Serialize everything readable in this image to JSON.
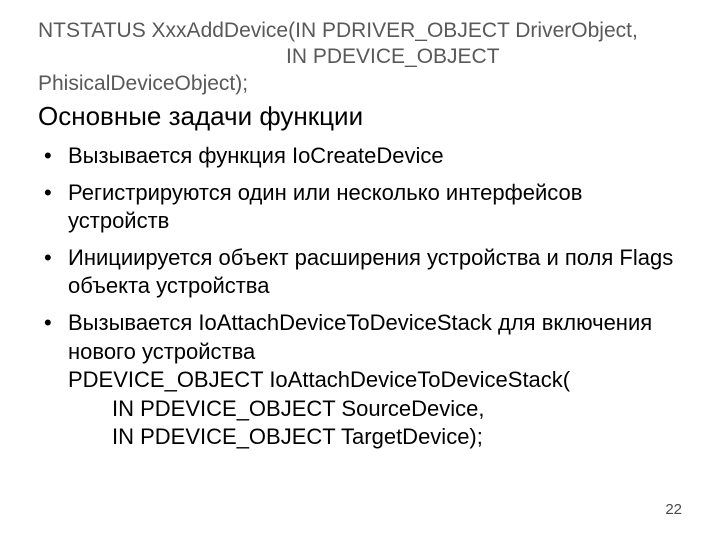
{
  "signature": {
    "line1": "NTSTATUS XxxAddDevice(IN PDRIVER_OBJECT DriverObject,",
    "line2": "IN PDEVICE_OBJECT",
    "line3": "PhisicalDeviceObject);"
  },
  "heading": "Основные задачи функции",
  "bullets": {
    "b1": "Вызывается функция IoCreateDevice",
    "b2": "Регистрируются один или несколько интерфейсов устройств",
    "b3": "Инициируется объект расширения устройства и поля Flags объекта устройства",
    "b4": {
      "l1": "Вызывается IoAttachDeviceToDeviceStack для включения нового устройства",
      "l2": "PDEVICE_OBJECT IoAttachDeviceToDeviceStack(",
      "l3": "IN PDEVICE_OBJECT SourceDevice,",
      "l4": "IN PDEVICE_OBJECT TargetDevice);"
    }
  },
  "page": "22"
}
